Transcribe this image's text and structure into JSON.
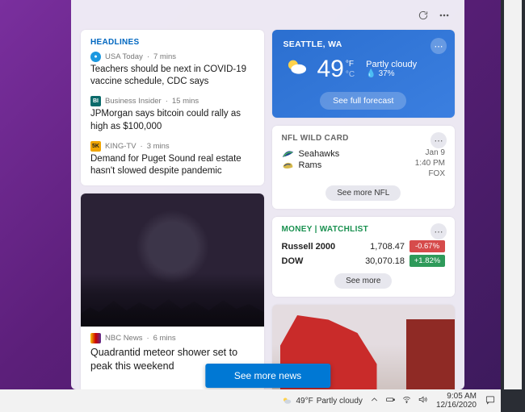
{
  "panel": {
    "headlines": {
      "label": "HEADLINES",
      "items": [
        {
          "source": "USA Today",
          "time": "7 mins",
          "title": "Teachers should be next in COVID-19 vaccine schedule, CDC says",
          "logo_bg": "#1b98e0",
          "logo_text": "●"
        },
        {
          "source": "Business Insider",
          "time": "15 mins",
          "title": "JPMorgan says bitcoin could rally as high as $100,000",
          "logo_bg": "#0b6b6b",
          "logo_text": "BI",
          "logo_square": true
        },
        {
          "source": "KING-TV",
          "time": "3 mins",
          "title": "Demand for Puget Sound real estate hasn't slowed despite pandemic",
          "logo_bg": "#f0a500",
          "logo_text": "5K",
          "logo_square": true
        }
      ]
    },
    "photo_headline": {
      "source": "NBC News",
      "time": "6 mins",
      "title": "Quadrantid meteor shower set to peak this weekend",
      "logo_bg": "#cc0000"
    },
    "weather": {
      "location": "SEATTLE, WA",
      "temp": "49",
      "unit_top": "°F",
      "unit_bottom": "°C",
      "condition": "Partly cloudy",
      "precip": "37%",
      "forecast_btn": "See full forecast"
    },
    "nfl": {
      "label": "NFL WILD CARD",
      "teams": [
        {
          "name": "Seahawks"
        },
        {
          "name": "Rams"
        }
      ],
      "date": "Jan 9",
      "time": "1:40 PM",
      "channel": "FOX",
      "more_btn": "See more NFL"
    },
    "money": {
      "label": "MONEY | WATCHLIST",
      "rows": [
        {
          "name": "Russell 2000",
          "value": "1,708.47",
          "change": "-0.67%",
          "dir": "neg"
        },
        {
          "name": "DOW",
          "value": "30,070.18",
          "change": "+1.82%",
          "dir": "pos"
        }
      ],
      "more_btn": "See more"
    },
    "see_more_news": "See more news"
  },
  "taskbar": {
    "temp": "49°F",
    "condition": "Partly cloudy",
    "time": "9:05 AM",
    "date": "12/16/2020"
  }
}
